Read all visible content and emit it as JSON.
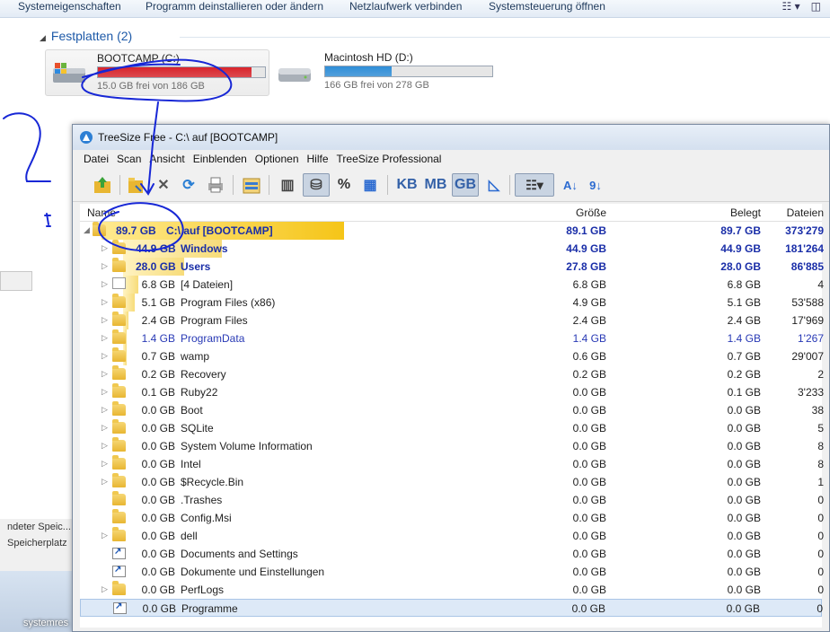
{
  "explorer": {
    "toolbar": [
      "Systemeigenschaften",
      "Programm deinstallieren oder ändern",
      "Netzlaufwerk verbinden",
      "Systemsteuerung öffnen"
    ],
    "section_title": "Festplatten (2)",
    "drives": [
      {
        "name": "BOOTCAMP (C:)",
        "free_text": "15.0 GB frei von 186 GB",
        "used_fraction": 0.92,
        "bar_color": "#d9242b"
      },
      {
        "name": "Macintosh HD (D:)",
        "free_text": "166 GB frei von 278 GB",
        "used_fraction": 0.4,
        "bar_color": "#2f8ed8"
      }
    ],
    "left_status_lines": [
      "ndeter Speic...",
      "Speicherplatz"
    ],
    "taskbar_label": "systemres"
  },
  "treesize": {
    "title": "TreeSize Free - C:\\  auf  [BOOTCAMP]",
    "menu": [
      "Datei",
      "Scan",
      "Ansicht",
      "Einblenden",
      "Optionen",
      "Hilfe",
      "TreeSize Professional"
    ],
    "unit_buttons": [
      "%",
      "KB",
      "MB",
      "GB"
    ],
    "columns": {
      "name": "Name",
      "size": "Größe",
      "allocated": "Belegt",
      "files": "Dateien"
    },
    "root": {
      "size": "89.7 GB",
      "name": "C:\\  auf  [BOOTCAMP]",
      "gr": "89.1 GB",
      "bel": "89.7 GB",
      "dat": "373'279"
    },
    "rows": [
      {
        "size": "44.9 GB",
        "name": "Windows",
        "gr": "44.9 GB",
        "bel": "44.9 GB",
        "dat": "181'264",
        "pct": 0.5,
        "bold": true,
        "type": "folder",
        "exp": true
      },
      {
        "size": "28.0 GB",
        "name": "Users",
        "gr": "27.8 GB",
        "bel": "28.0 GB",
        "dat": "86'885",
        "pct": 0.31,
        "bold": true,
        "type": "folder",
        "exp": true
      },
      {
        "size": "6.8 GB",
        "name": "[4 Dateien]",
        "gr": "6.8 GB",
        "bel": "6.8 GB",
        "dat": "4",
        "pct": 0.076,
        "type": "file",
        "exp": true
      },
      {
        "size": "5.1 GB",
        "name": "Program Files (x86)",
        "gr": "4.9 GB",
        "bel": "5.1 GB",
        "dat": "53'588",
        "pct": 0.057,
        "type": "folder",
        "exp": true
      },
      {
        "size": "2.4 GB",
        "name": "Program Files",
        "gr": "2.4 GB",
        "bel": "2.4 GB",
        "dat": "17'969",
        "pct": 0.027,
        "type": "folder",
        "exp": true
      },
      {
        "size": "1.4 GB",
        "name": "ProgramData",
        "gr": "1.4 GB",
        "bel": "1.4 GB",
        "dat": "1'267",
        "pct": 0.016,
        "type": "folder",
        "exp": true,
        "blue": true
      },
      {
        "size": "0.7 GB",
        "name": "wamp",
        "gr": "0.6 GB",
        "bel": "0.7 GB",
        "dat": "29'007",
        "pct": 0.008,
        "type": "folder",
        "exp": true
      },
      {
        "size": "0.2 GB",
        "name": "Recovery",
        "gr": "0.2 GB",
        "bel": "0.2 GB",
        "dat": "2",
        "type": "folder",
        "exp": true
      },
      {
        "size": "0.1 GB",
        "name": "Ruby22",
        "gr": "0.0 GB",
        "bel": "0.1 GB",
        "dat": "3'233",
        "type": "folder",
        "exp": true
      },
      {
        "size": "0.0 GB",
        "name": "Boot",
        "gr": "0.0 GB",
        "bel": "0.0 GB",
        "dat": "38",
        "type": "folder",
        "exp": true
      },
      {
        "size": "0.0 GB",
        "name": "SQLite",
        "gr": "0.0 GB",
        "bel": "0.0 GB",
        "dat": "5",
        "type": "folder",
        "exp": true
      },
      {
        "size": "0.0 GB",
        "name": "System Volume Information",
        "gr": "0.0 GB",
        "bel": "0.0 GB",
        "dat": "8",
        "type": "folder",
        "exp": true
      },
      {
        "size": "0.0 GB",
        "name": "Intel",
        "gr": "0.0 GB",
        "bel": "0.0 GB",
        "dat": "8",
        "type": "folder",
        "exp": true
      },
      {
        "size": "0.0 GB",
        "name": "$Recycle.Bin",
        "gr": "0.0 GB",
        "bel": "0.0 GB",
        "dat": "1",
        "type": "folder",
        "exp": true
      },
      {
        "size": "0.0 GB",
        "name": ".Trashes",
        "gr": "0.0 GB",
        "bel": "0.0 GB",
        "dat": "0",
        "type": "folder",
        "exp": false
      },
      {
        "size": "0.0 GB",
        "name": "Config.Msi",
        "gr": "0.0 GB",
        "bel": "0.0 GB",
        "dat": "0",
        "type": "folder",
        "exp": false
      },
      {
        "size": "0.0 GB",
        "name": "dell",
        "gr": "0.0 GB",
        "bel": "0.0 GB",
        "dat": "0",
        "type": "folder",
        "exp": true
      },
      {
        "size": "0.0 GB",
        "name": "Documents and Settings",
        "gr": "0.0 GB",
        "bel": "0.0 GB",
        "dat": "0",
        "type": "link",
        "exp": false
      },
      {
        "size": "0.0 GB",
        "name": "Dokumente und Einstellungen",
        "gr": "0.0 GB",
        "bel": "0.0 GB",
        "dat": "0",
        "type": "link",
        "exp": false
      },
      {
        "size": "0.0 GB",
        "name": "PerfLogs",
        "gr": "0.0 GB",
        "bel": "0.0 GB",
        "dat": "0",
        "type": "folder",
        "exp": true
      },
      {
        "size": "0.0 GB",
        "name": "Programme",
        "gr": "0.0 GB",
        "bel": "0.0 GB",
        "dat": "0",
        "type": "link",
        "exp": false,
        "selected": true
      }
    ]
  },
  "annotation": {
    "digit": "2",
    "color": "#1727d6"
  }
}
